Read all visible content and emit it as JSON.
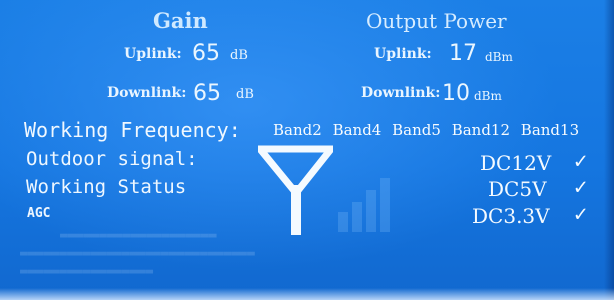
{
  "gain": {
    "title": "Gain",
    "uplink_label": "Uplink:",
    "uplink_value": "65",
    "uplink_unit": "dB",
    "downlink_label": "Downlink:",
    "downlink_value": "65",
    "downlink_unit": "dB"
  },
  "output_power": {
    "title": "Output Power",
    "uplink_label": "Uplink:",
    "uplink_value": "17",
    "uplink_unit": "dBm",
    "downlink_label": "Downlink:",
    "downlink_value": "10",
    "downlink_unit": "dBm"
  },
  "working_frequency": {
    "label": "Working Frequency:",
    "bands": [
      "Band2",
      "Band4",
      "Band5",
      "Band12",
      "Band13"
    ]
  },
  "outdoor_signal": {
    "label": "Outdoor signal:"
  },
  "working_status": {
    "label": "Working Status"
  },
  "agc": {
    "label": "AGC"
  },
  "power_rails": [
    {
      "label": "DC12V",
      "status": "✓"
    },
    {
      "label": "DC5V",
      "status": "✓"
    },
    {
      "label": "DC3.3V",
      "status": "✓"
    }
  ],
  "colors": {
    "background": "#1576e0",
    "text": "#eaf6ff"
  },
  "icons": {
    "antenna": "antenna-icon",
    "signal_bars": "signal-bars-icon",
    "check": "check-icon"
  }
}
